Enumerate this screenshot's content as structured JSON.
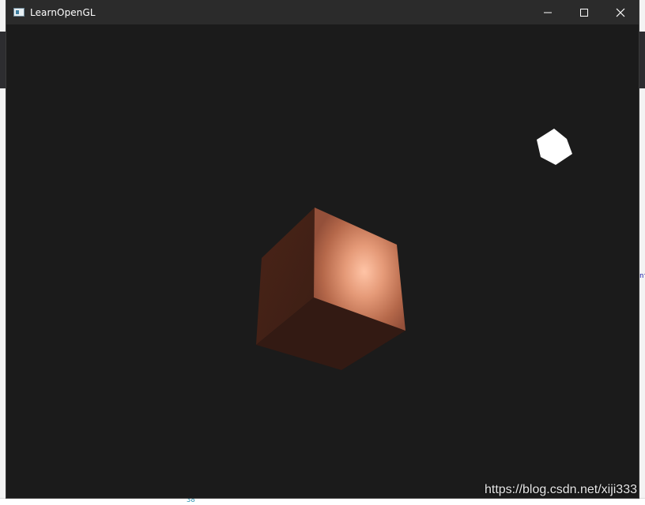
{
  "window": {
    "title": "LearnOpenGL",
    "controls": {
      "minimize_icon": "minimize-icon",
      "maximize_icon": "maximize-icon",
      "close_icon": "close-icon"
    }
  },
  "scene": {
    "background_color": "#1b1b1b",
    "object_color": "#c87850",
    "light_color": "#ffffff"
  },
  "watermark": "https://blog.csdn.net/xiji333",
  "background_fragments": {
    "right_code": "nt",
    "bottom_line_number": "38"
  }
}
